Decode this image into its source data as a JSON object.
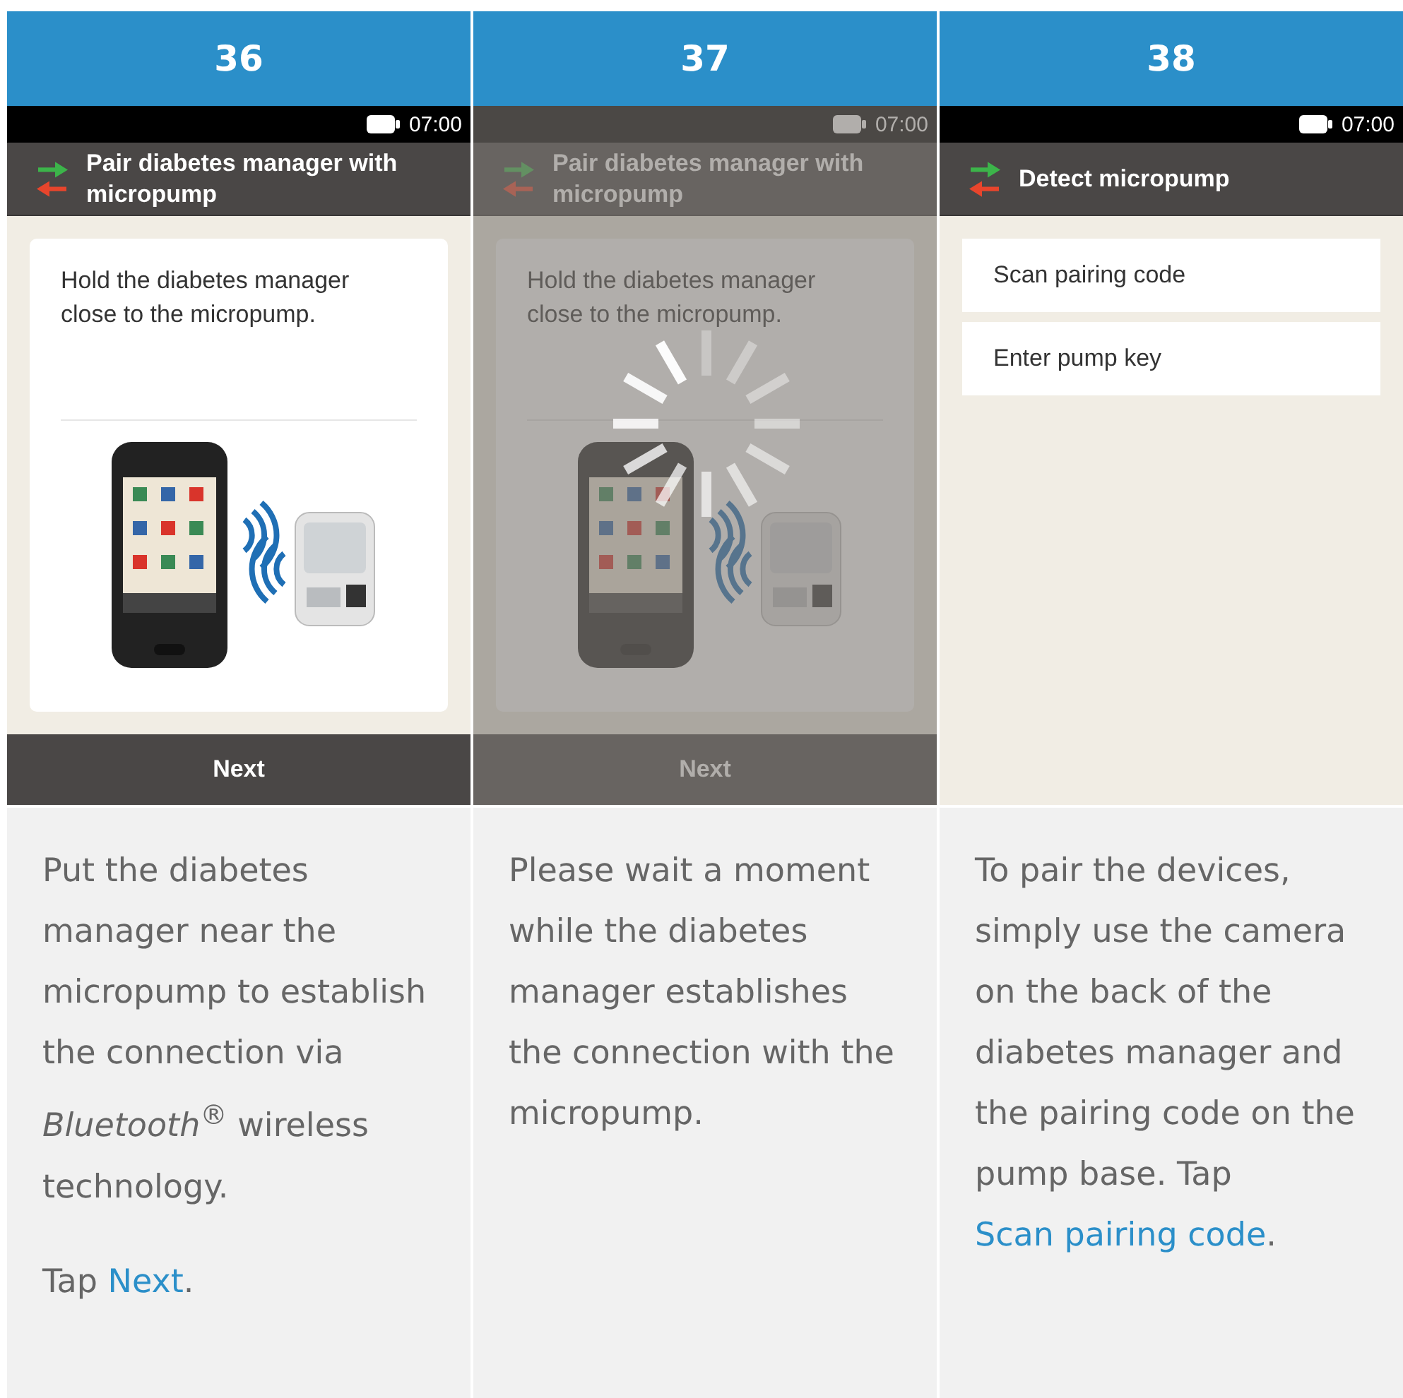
{
  "steps": [
    {
      "number": "36",
      "screen": {
        "time": "07:00",
        "title": "Pair diabetes manager with micropump",
        "dimmed": false,
        "kind": "card",
        "card_text": "Hold the diabetes manager close to the micropump.",
        "button": "Next"
      },
      "description": [
        [
          {
            "kind": "text",
            "text": "Put the diabetes manager near the micropump to establish the connection via *Bluetooth*$^{®}$ wireless technology."
          }
        ],
        [
          {
            "kind": "text",
            "text": "Tap "
          },
          {
            "kind": "link",
            "text": "Next"
          },
          {
            "kind": "text",
            "text": "."
          }
        ]
      ]
    },
    {
      "number": "37",
      "screen": {
        "time": "07:00",
        "title": "Pair diabetes manager with micropump",
        "dimmed": true,
        "kind": "card",
        "card_text": "Hold the diabetes manager close to the micropump.",
        "button": "Next"
      },
      "description": [
        [
          {
            "kind": "text",
            "text": "Please wait a moment while the diabetes manager establishes the connection with the micropump."
          }
        ]
      ]
    },
    {
      "number": "38",
      "screen": {
        "time": "07:00",
        "title": "Detect micropump",
        "dimmed": false,
        "kind": "menu",
        "options": [
          "Scan pairing code",
          "Enter pump key"
        ]
      },
      "description": [
        [
          {
            "kind": "text",
            "text": "To pair the devices, simply use the camera on the back of the diabetes manager and the pairing code on the pump base. Tap "
          },
          {
            "kind": "link",
            "text": "Scan pairing code"
          },
          {
            "kind": "text",
            "text": "."
          }
        ]
      ]
    }
  ]
}
